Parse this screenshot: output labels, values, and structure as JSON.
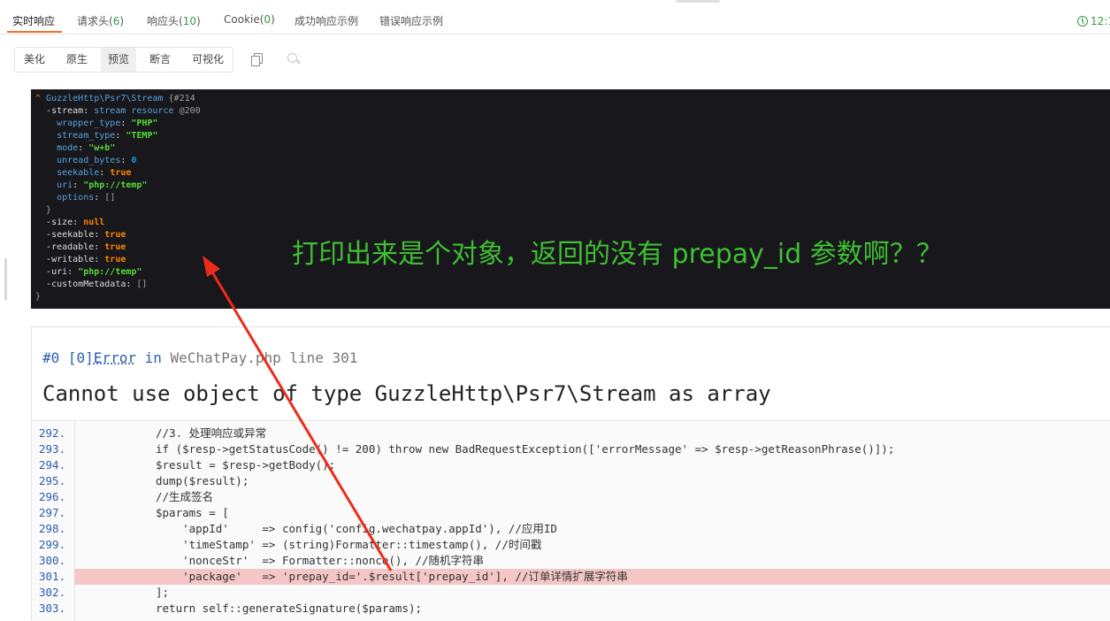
{
  "tabs": [
    {
      "label": "实时响应",
      "count": ""
    },
    {
      "label": "请求头",
      "count": "6"
    },
    {
      "label": "响应头",
      "count": "10"
    },
    {
      "label": "Cookie",
      "count": "0"
    },
    {
      "label": "成功响应示例",
      "count": ""
    },
    {
      "label": "错误响应示例",
      "count": ""
    }
  ],
  "time_label": "12:1",
  "view_buttons": [
    "美化",
    "原生",
    "预览",
    "断言",
    "可视化"
  ],
  "active_view": "预览",
  "dump": {
    "class": "GuzzleHttp\\Psr7\\Stream",
    "id": "{#214",
    "stream_key": "-stream",
    "stream_res": "stream resource",
    "stream_id": "@200",
    "props": [
      {
        "k": "wrapper_type",
        "v": "\"PHP\"",
        "t": "str"
      },
      {
        "k": "stream_type",
        "v": "\"TEMP\"",
        "t": "str"
      },
      {
        "k": "mode",
        "v": "\"w+b\"",
        "t": "str"
      },
      {
        "k": "unread_bytes",
        "v": "0",
        "t": "num"
      },
      {
        "k": "seekable",
        "v": "true",
        "t": "const"
      },
      {
        "k": "uri",
        "v": "\"php://temp\"",
        "t": "str"
      },
      {
        "k": "options",
        "v": "[]",
        "t": "br"
      }
    ],
    "fields": [
      {
        "k": "-size",
        "v": "null",
        "t": "const"
      },
      {
        "k": "-seekable",
        "v": "true",
        "t": "const"
      },
      {
        "k": "-readable",
        "v": "true",
        "t": "const"
      },
      {
        "k": "-writable",
        "v": "true",
        "t": "const"
      },
      {
        "k": "-uri",
        "v": "\"php://temp\"",
        "t": "str"
      },
      {
        "k": "-customMetadata",
        "v": "[]",
        "t": "br"
      }
    ]
  },
  "annotation": "打印出来是个对象，返回的没有 prepay_id 参数啊？？",
  "error": {
    "prefix": "#0 [0]",
    "type": "Error",
    "in": " in ",
    "file": "WeChatPay.php line 301",
    "message": "Cannot use object of type GuzzleHttp\\Psr7\\Stream as array"
  },
  "code_lines": [
    {
      "n": "292.",
      "code": "//3. 处理响应或异常"
    },
    {
      "n": "293.",
      "code": "if ($resp->getStatusCode() != 200) throw new BadRequestException(['errorMessage' => $resp->getReasonPhrase()]);"
    },
    {
      "n": "294.",
      "code": "$result = $resp->getBody();"
    },
    {
      "n": "295.",
      "code": "dump($result);"
    },
    {
      "n": "296.",
      "code": "//生成签名"
    },
    {
      "n": "297.",
      "code": "$params = ["
    },
    {
      "n": "298.",
      "code": "    'appId'     => config('config.wechatpay.appId'), //应用ID"
    },
    {
      "n": "299.",
      "code": "    'timeStamp' => (string)Formatter::timestamp(), //时间戳"
    },
    {
      "n": "300.",
      "code": "    'nonceStr'  => Formatter::nonce(), //随机字符串"
    },
    {
      "n": "301.",
      "code": "    'package'   => 'prepay_id='.$result['prepay_id'], //订单详情扩展字符串"
    },
    {
      "n": "302.",
      "code": "];"
    },
    {
      "n": "303.",
      "code": "return self::generateSignature($params);"
    }
  ],
  "highlight_line": "301.",
  "colors": {
    "accent": "#f0712c",
    "count_green": "#2e9e3f",
    "annotation_green": "#3fbf33",
    "highlight": "#f5c6c6",
    "arrow": "#ee2a1b"
  }
}
